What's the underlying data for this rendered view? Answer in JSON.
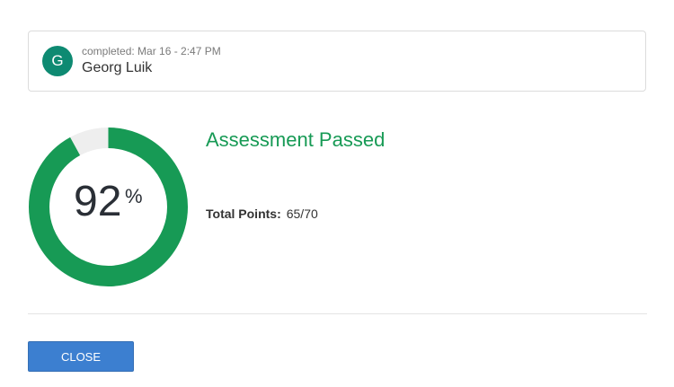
{
  "user": {
    "avatar_letter": "G",
    "completed": "completed: Mar 16 - 2:47 PM",
    "name": "Georg Luik"
  },
  "score": {
    "value": "92",
    "unit": "%",
    "percent": 92
  },
  "result": {
    "title": "Assessment Passed",
    "points_label": "Total Points:",
    "points_value": "65/70"
  },
  "actions": {
    "close_label": "CLOSE"
  },
  "colors": {
    "ring_fill": "#179a55",
    "ring_track": "#eeeeee",
    "avatar": "#0e8a72",
    "button": "#3c7fd0"
  }
}
